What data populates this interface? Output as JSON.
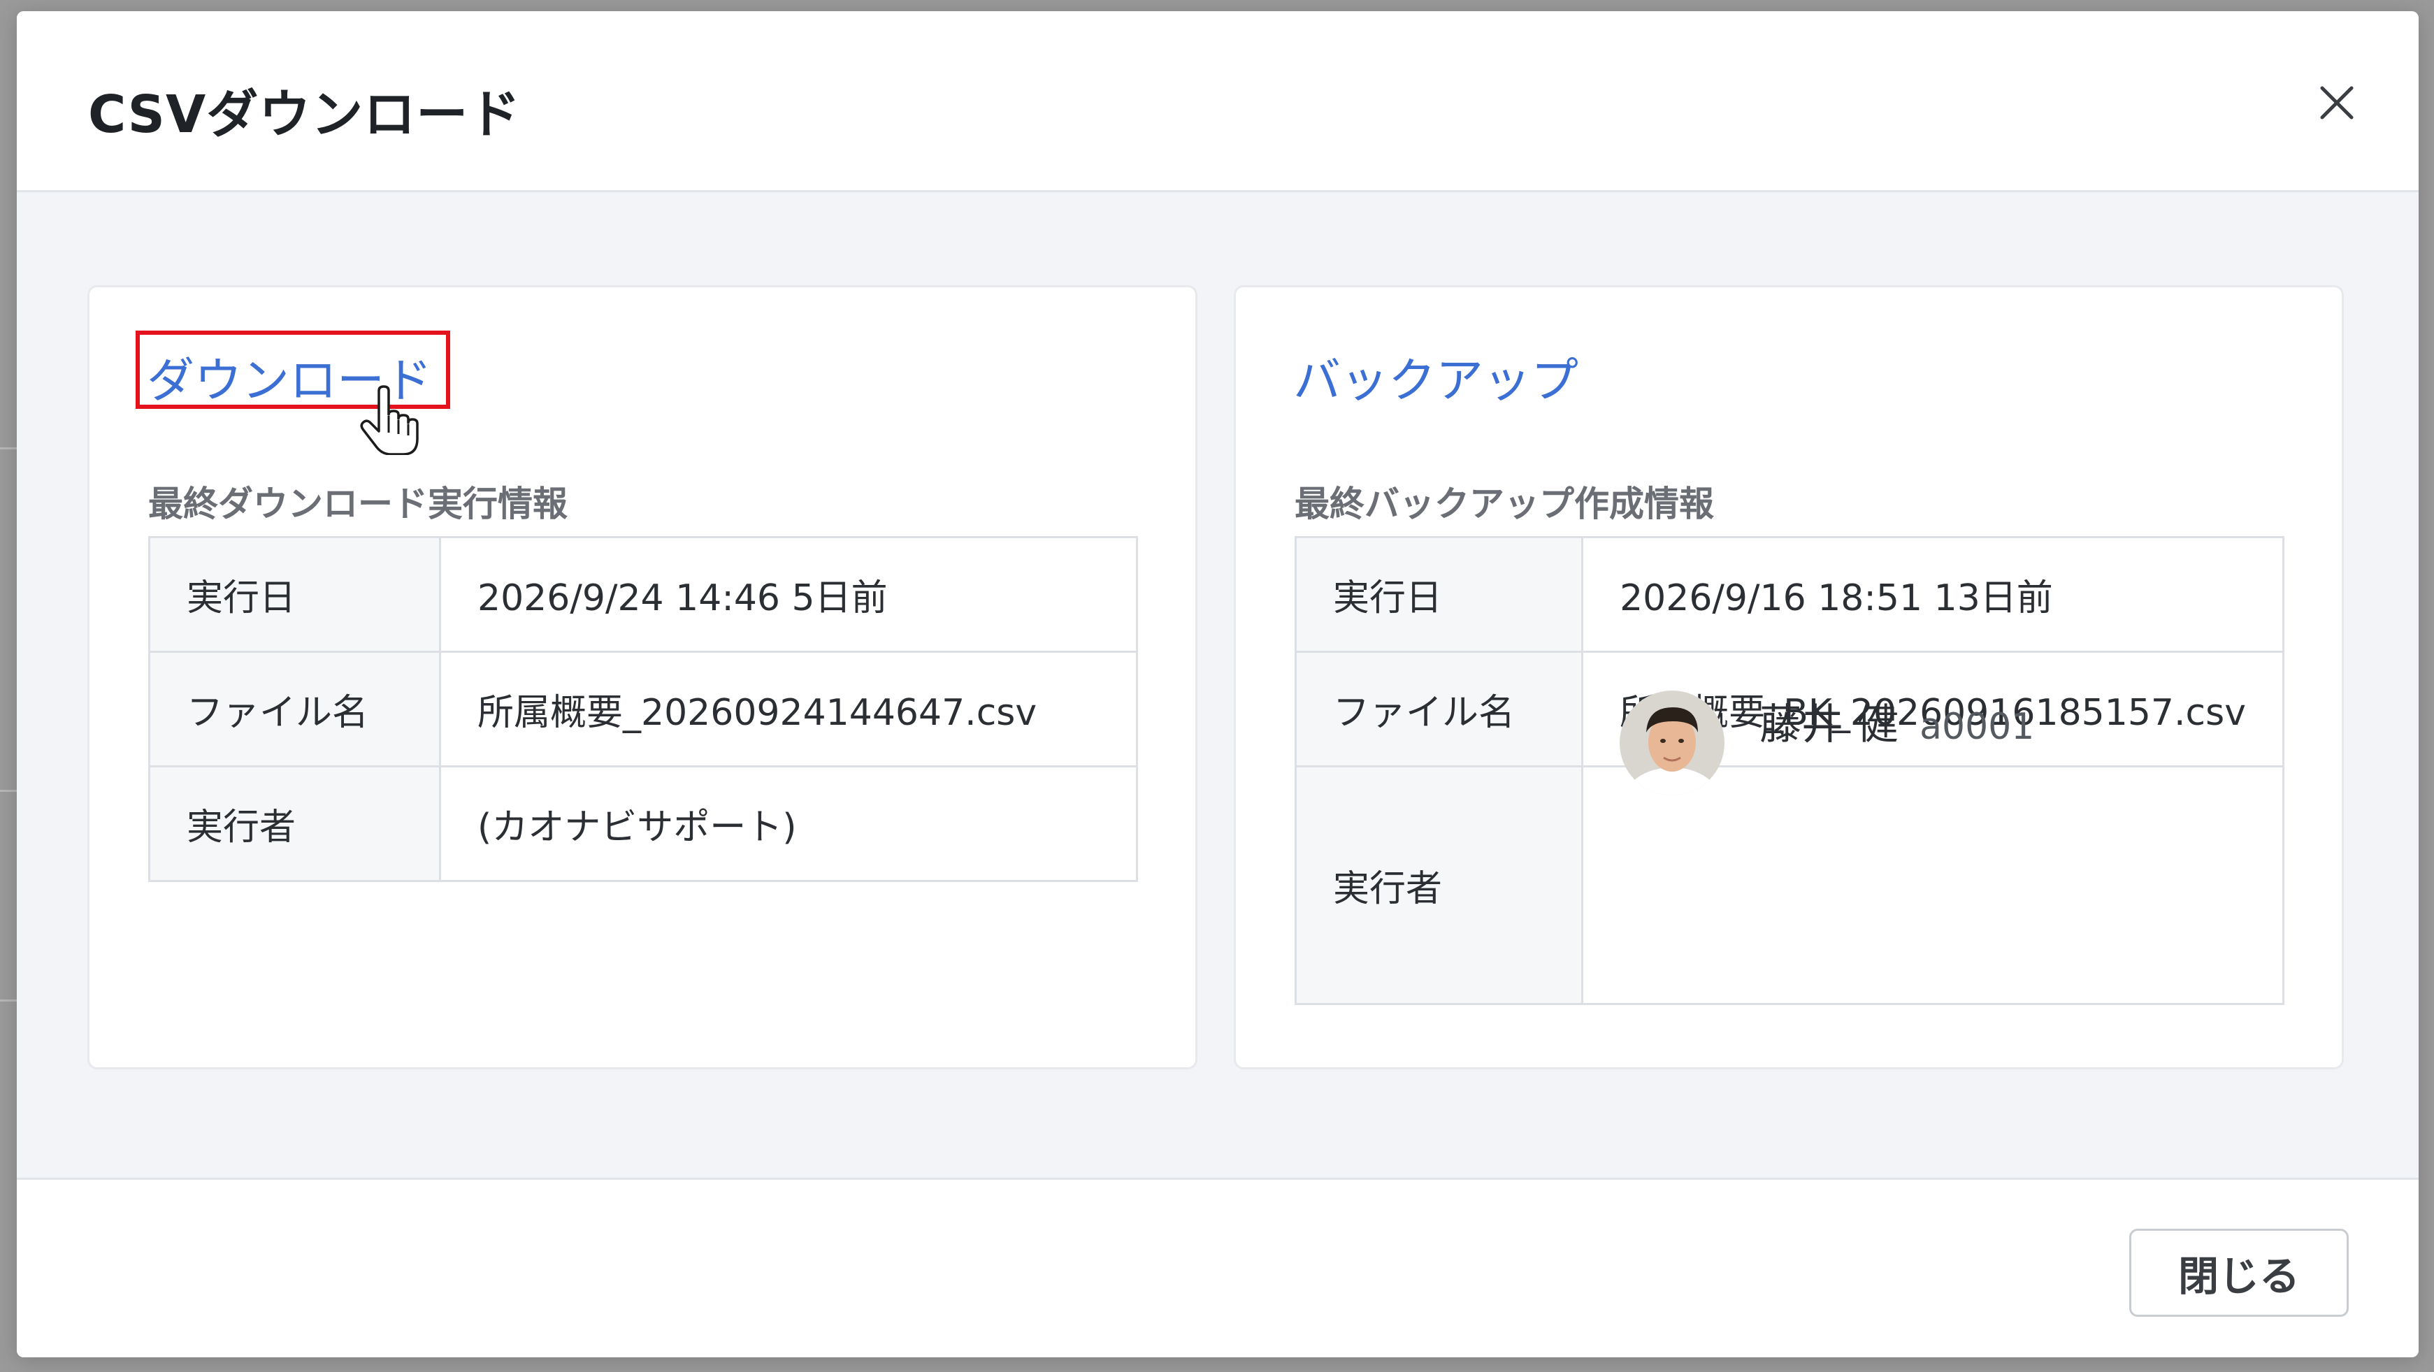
{
  "modal": {
    "title": "CSVダウンロード",
    "close_icon": "close-icon",
    "footer_close_label": "閉じる"
  },
  "download": {
    "link_label": "ダウンロード",
    "section_label": "最終ダウンロード実行情報",
    "rows": [
      {
        "key": "実行日",
        "value": "2026/9/24 14:46 5日前"
      },
      {
        "key": "ファイル名",
        "value": "所属概要_20260924144647.csv"
      },
      {
        "key": "実行者",
        "value": "(カオナビサポート)"
      }
    ]
  },
  "backup": {
    "link_label": "バックアップ",
    "section_label": "最終バックアップ作成情報",
    "rows": [
      {
        "key": "実行日",
        "value": "2026/9/16 18:51 13日前"
      },
      {
        "key": "ファイル名",
        "value": "所属概要_BK_20260916185157.csv"
      },
      {
        "key": "実行者"
      }
    ],
    "user": {
      "name": "藤井 健",
      "id": "a0001"
    }
  },
  "colors": {
    "link": "#3b6fd4",
    "highlight": "#e3121c"
  }
}
